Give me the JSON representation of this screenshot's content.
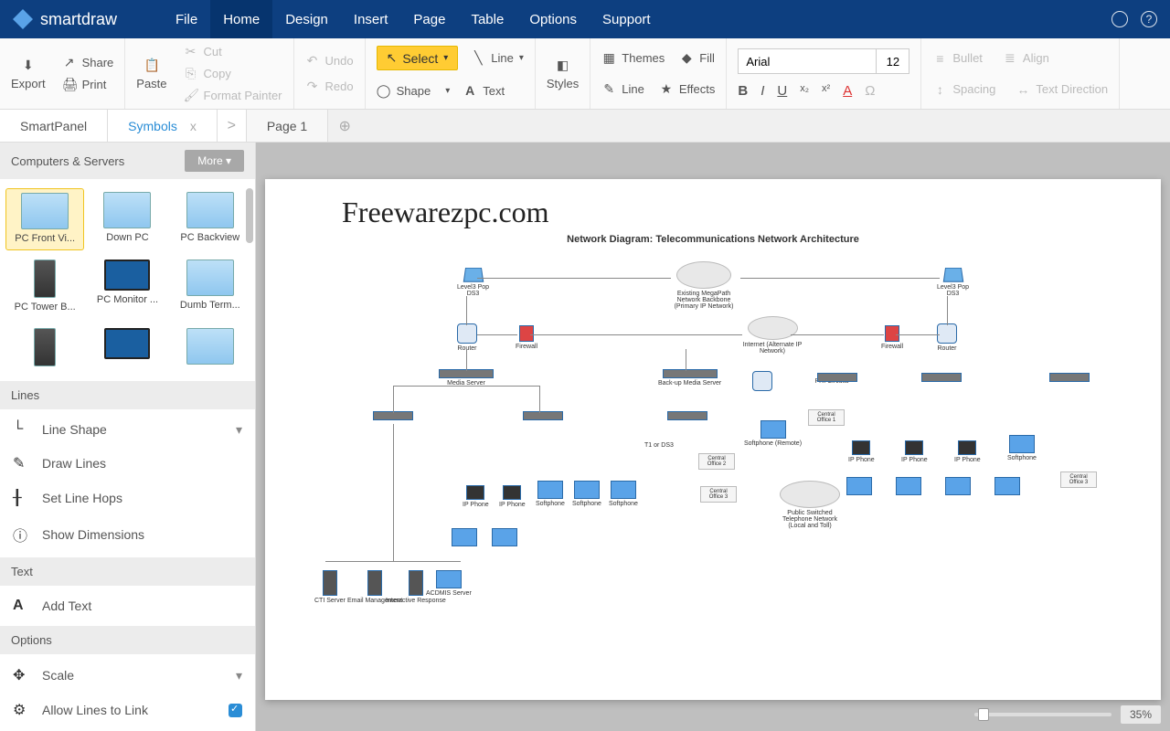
{
  "app": {
    "brand": "smartdraw"
  },
  "menu": {
    "items": [
      "File",
      "Home",
      "Design",
      "Insert",
      "Page",
      "Table",
      "Options",
      "Support"
    ],
    "active": "Home"
  },
  "ribbon": {
    "export": "Export",
    "share": "Share",
    "print": "Print",
    "paste": "Paste",
    "cut": "Cut",
    "copy": "Copy",
    "format_painter": "Format Painter",
    "undo": "Undo",
    "redo": "Redo",
    "select": "Select",
    "shape": "Shape",
    "line": "Line",
    "text": "Text",
    "styles": "Styles",
    "themes": "Themes",
    "fill": "Fill",
    "line2": "Line",
    "effects": "Effects",
    "font_name": "Arial",
    "font_size": "12",
    "bullet": "Bullet",
    "align": "Align",
    "spacing": "Spacing",
    "text_direction": "Text Direction"
  },
  "tabs": {
    "panel": "SmartPanel",
    "symbols": "Symbols",
    "page": "Page 1"
  },
  "sidebar": {
    "symbols_header": "Computers & Servers",
    "more": "More",
    "symbols": [
      {
        "label": "PC Front Vi..."
      },
      {
        "label": "Down PC"
      },
      {
        "label": "PC Backview"
      },
      {
        "label": "PC Tower B..."
      },
      {
        "label": "PC Monitor ..."
      },
      {
        "label": "Dumb Term..."
      },
      {
        "label": ""
      },
      {
        "label": ""
      },
      {
        "label": ""
      }
    ],
    "lines_header": "Lines",
    "lines_items": [
      "Line Shape",
      "Draw Lines",
      "Set Line Hops",
      "Show Dimensions"
    ],
    "text_header": "Text",
    "text_items": [
      "Add Text"
    ],
    "options_header": "Options",
    "options_items": [
      "Scale",
      "Allow Lines to Link"
    ]
  },
  "canvas": {
    "watermark": "Freewarezpc.com",
    "title": "Network Diagram: Telecommunications Network Architecture",
    "nodes": {
      "backbone": "Existing MegaPath Network Backbone (Primary IP Network)",
      "l3pop_left": "Level3 Pop",
      "l3pop_right": "Level3 Pop",
      "ds3_l": "DS3",
      "ds3_r": "DS3",
      "router_l": "Router",
      "firewall_l": "Firewall",
      "internet": "Internet (Alternate IP Network)",
      "firewall_r": "Firewall",
      "router_r": "Router",
      "media_server": "Media Server",
      "backup_media": "Back-up Media Server",
      "t1": "T1 or DS3",
      "pri": "PRI Circuits",
      "co1": "Central Office 1",
      "co2": "Central Office 2",
      "co3": "Central Office 3",
      "softphone_remote": "Softphone (Remote)",
      "pstn": "Public Switched Telephone Network (Local and Toll)",
      "ipphone": "IP Phone",
      "softphone": "Softphone",
      "cti": "CTI Server",
      "email": "Email Management",
      "ivr": "Interactive Response",
      "acdmis": "ACDMIS Server"
    }
  },
  "zoom": {
    "value": "35%"
  }
}
